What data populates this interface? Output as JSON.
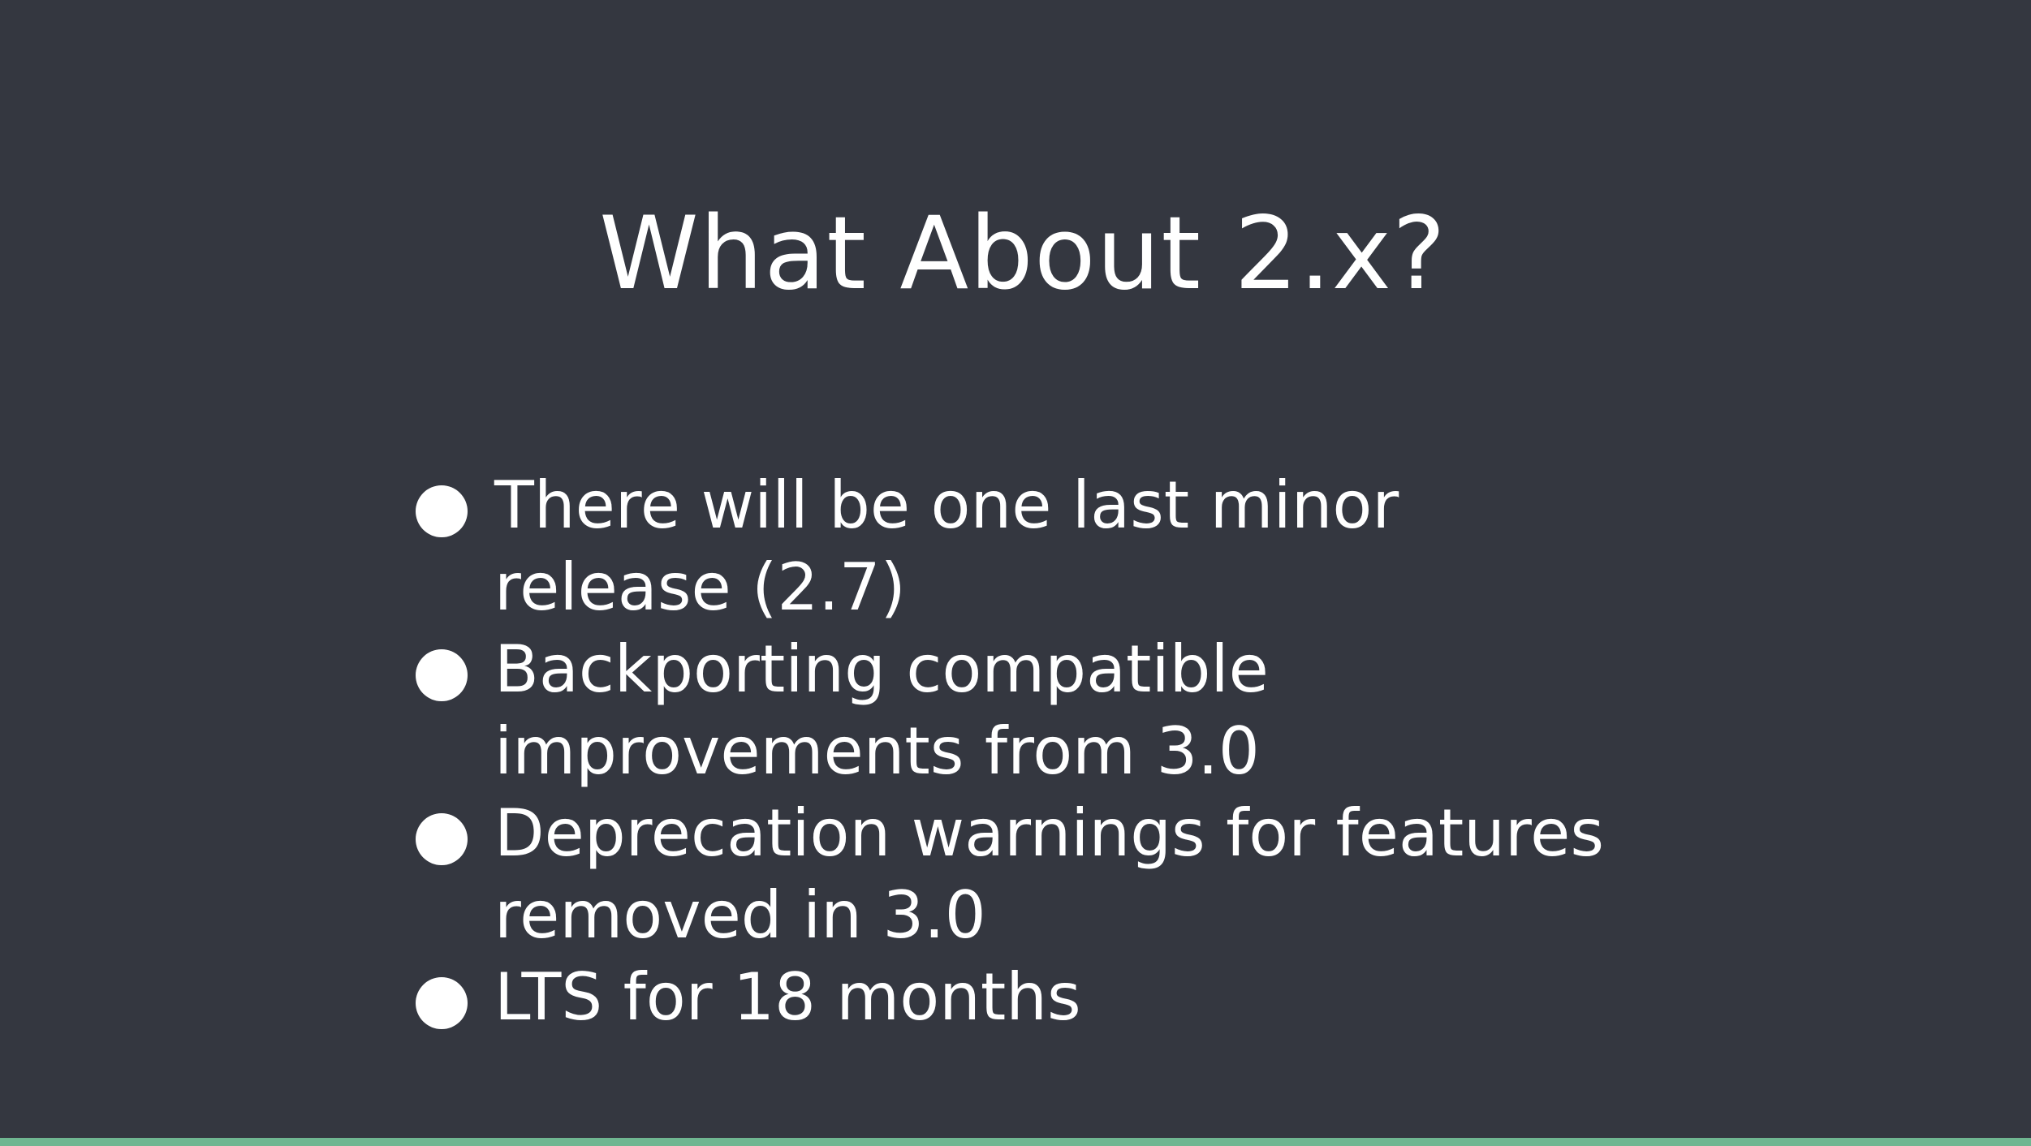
{
  "slide": {
    "title": "What About 2.x?",
    "bullets": [
      {
        "text": "There will be one last minor\nrelease (2.7)"
      },
      {
        "text": "Backporting compatible\nimprovements from 3.0"
      },
      {
        "text": "Deprecation warnings for features\nremoved in 3.0"
      },
      {
        "text": "LTS for 18 months"
      }
    ]
  },
  "colors": {
    "background": "#343740",
    "text": "#ffffff",
    "accent_bar": "#6fb691"
  }
}
